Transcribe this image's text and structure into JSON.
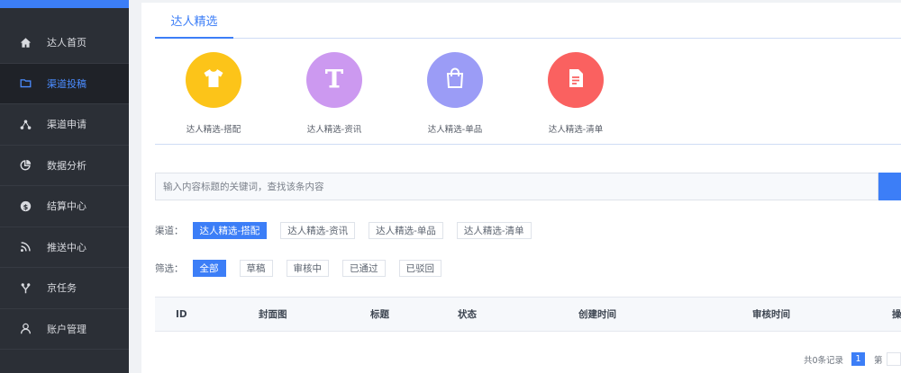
{
  "sidebar": {
    "accent": "#3c7ef7",
    "items": [
      {
        "label": "达人首页",
        "icon": "home-icon"
      },
      {
        "label": "渠道投稿",
        "icon": "folder-icon",
        "active": true
      },
      {
        "label": "渠道申请",
        "icon": "share-icon"
      },
      {
        "label": "数据分析",
        "icon": "pie-chart-icon"
      },
      {
        "label": "结算中心",
        "icon": "dollar-icon"
      },
      {
        "label": "推送中心",
        "icon": "rss-icon"
      },
      {
        "label": "京任务",
        "icon": "task-icon"
      },
      {
        "label": "账户管理",
        "icon": "user-icon"
      }
    ]
  },
  "main": {
    "tab": "达人精选",
    "channels": [
      {
        "label": "达人精选-搭配",
        "icon": "tshirt-icon",
        "color": "#fcc419"
      },
      {
        "label": "达人精选-资讯",
        "icon": "letter-t-icon",
        "color": "#cc99f0"
      },
      {
        "label": "达人精选-单品",
        "icon": "shopping-bag-icon",
        "color": "#9b9cf6"
      },
      {
        "label": "达人精选-清单",
        "icon": "document-icon",
        "color": "#fa6160"
      }
    ],
    "search": {
      "placeholder": "输入内容标题的关键词，查找该条内容"
    },
    "channel_filter": {
      "label": "渠道：",
      "options": [
        "达人精选-搭配",
        "达人精选-资讯",
        "达人精选-单品",
        "达人精选-清单"
      ],
      "selected": "达人精选-搭配"
    },
    "status_filter": {
      "label": "筛选：",
      "options": [
        "全部",
        "草稿",
        "审核中",
        "已通过",
        "已驳回"
      ],
      "selected": "全部"
    },
    "table": {
      "columns": [
        "ID",
        "封面图",
        "标题",
        "状态",
        "创建时间",
        "审核时间",
        "操"
      ]
    },
    "pagination": {
      "total_text": "共0条记录",
      "current_page": "1",
      "jump_label": "第"
    }
  }
}
